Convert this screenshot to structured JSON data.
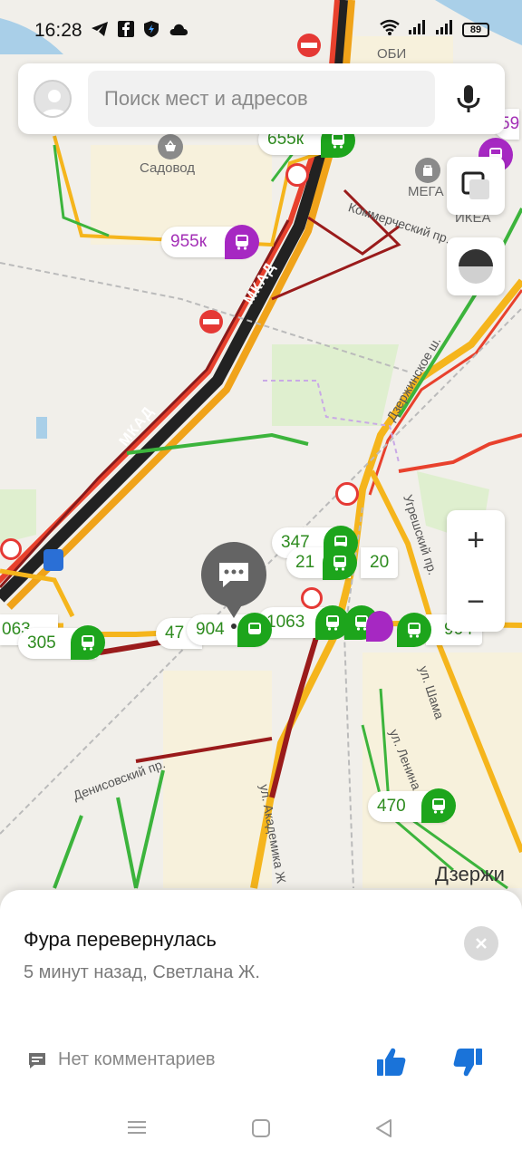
{
  "status": {
    "time": "16:28",
    "battery": "89"
  },
  "search": {
    "placeholder": "Поиск мест и адресов"
  },
  "map": {
    "places": [
      "Садовод",
      "МЕГА",
      "ИКЕА",
      "ОБИ",
      "Дзержи"
    ],
    "roads": [
      "МКАД",
      "МКАД",
      "Дзержинское ш.",
      "Угрешский пр.",
      "ул. Шама",
      "ул. Ленина",
      "ул. Академика Ж",
      "Денисовский пр.",
      "Коммерческий пр."
    ],
    "stops": [
      {
        "label": "655к",
        "color": "green"
      },
      {
        "label": "955к",
        "color": "purple"
      },
      {
        "label": "347",
        "color": "green"
      },
      {
        "label": "21",
        "color": "green"
      },
      {
        "label": "20",
        "color": "green"
      },
      {
        "label": "904",
        "color": "green"
      },
      {
        "label": "1063",
        "color": "green"
      },
      {
        "label": "904",
        "color": "green"
      },
      {
        "label": "305",
        "color": "green"
      },
      {
        "label": "063",
        "color": "green"
      },
      {
        "label": "47",
        "color": "green"
      },
      {
        "label": "470",
        "color": "green"
      },
      {
        "label": "59",
        "color": "purple"
      }
    ],
    "zoom_in": "+",
    "zoom_out": "−"
  },
  "event": {
    "title": "Фура перевернулась",
    "meta": "5 минут назад, Светлана Ж.",
    "comments": "Нет комментариев"
  },
  "colors": {
    "green": "#1da51c",
    "purple": "#a628c2",
    "thumbs": "#1a73d9"
  }
}
